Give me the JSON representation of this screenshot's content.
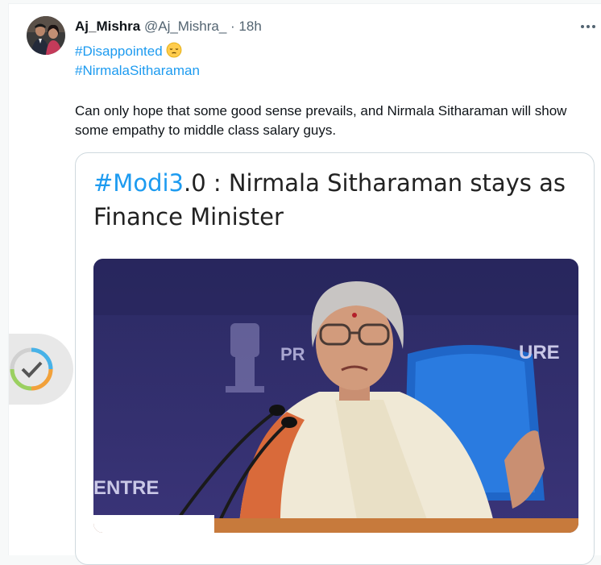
{
  "tweet": {
    "author_name": "Aj_Mishra",
    "author_handle": "@Aj_Mishra_",
    "separator": "·",
    "time": "18h",
    "hashtags": [
      "#Disappointed",
      "#NirmalaSitharaman"
    ],
    "text": "Can only hope that some good sense prevails, and Nirmala Sitharaman will show some empathy to middle class salary guys."
  },
  "card": {
    "headline_tag": "#Modi3",
    "headline_rest": ".0 : Nirmala Sitharaman stays as Finance Minister",
    "photo_text_left": "PR",
    "photo_text_right": "URE",
    "photo_text_bottom": "ENTRE"
  },
  "icons": {
    "more": "more-horizontal-icon",
    "verify": "checkmark-badge-icon",
    "emoji": "pensive-face-emoji"
  },
  "colors": {
    "link": "#1d9bf0",
    "text": "#0f1419",
    "muted": "#536471",
    "border": "#cfd9de"
  }
}
